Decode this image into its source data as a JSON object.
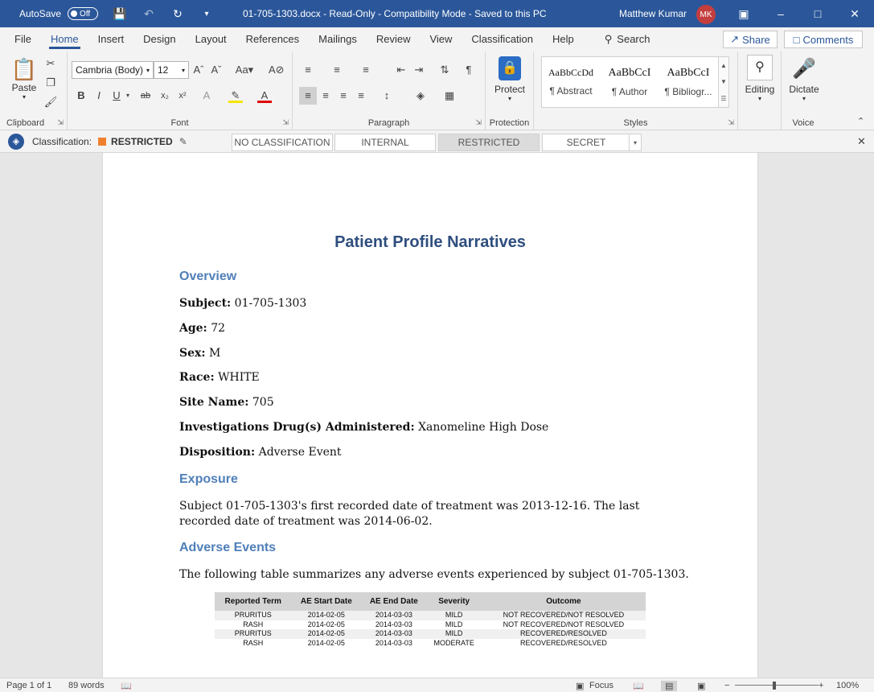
{
  "titlebar": {
    "autosave_label": "AutoSave",
    "autosave_state": "Off",
    "title": "01-705-1303.docx  -  Read-Only  -  Compatibility Mode  -  Saved to this PC",
    "user_name": "Matthew Kumar",
    "user_initials": "MK"
  },
  "tabs": [
    "File",
    "Home",
    "Insert",
    "Design",
    "Layout",
    "References",
    "Mailings",
    "Review",
    "View",
    "Classification",
    "Help"
  ],
  "active_tab": "Home",
  "search_label": "Search",
  "share_label": "Share",
  "comments_label": "Comments",
  "ribbon": {
    "clipboard": {
      "label": "Clipboard",
      "paste": "Paste"
    },
    "font": {
      "label": "Font",
      "family": "Cambria (Body)",
      "size": "12"
    },
    "paragraph": {
      "label": "Paragraph"
    },
    "protection": {
      "label": "Protection",
      "protect": "Protect"
    },
    "styles": {
      "label": "Styles",
      "items": [
        {
          "sample": "AaBbCcDd",
          "name": "¶ Abstract"
        },
        {
          "sample": "AaBbCcI",
          "name": "¶ Author"
        },
        {
          "sample": "AaBbCcI",
          "name": "¶ Bibliogr..."
        }
      ]
    },
    "editing": {
      "label": "Editing"
    },
    "voice": {
      "label": "Voice",
      "dictate": "Dictate"
    }
  },
  "classification": {
    "label": "Classification:",
    "current": "RESTRICTED",
    "swatch_color": "#f08030",
    "options": [
      "NO CLASSIFICATION",
      "INTERNAL",
      "RESTRICTED",
      "SECRET"
    ],
    "selected": "RESTRICTED"
  },
  "document": {
    "title": "Patient Profile Narratives",
    "overview_heading": "Overview",
    "fields": [
      {
        "label": "Subject:",
        "value": "01-705-1303"
      },
      {
        "label": "Age:",
        "value": "72"
      },
      {
        "label": "Sex:",
        "value": "M"
      },
      {
        "label": "Race:",
        "value": "WHITE"
      },
      {
        "label": "Site Name:",
        "value": "705"
      },
      {
        "label": "Investigations Drug(s) Administered:",
        "value": "Xanomeline High Dose"
      },
      {
        "label": "Disposition:",
        "value": "Adverse Event"
      }
    ],
    "exposure_heading": "Exposure",
    "exposure_text": "Subject 01-705-1303's first recorded date of treatment was 2013-12-16. The last recorded date of treatment was 2014-06-02.",
    "ae_heading": "Adverse Events",
    "ae_text": "The following table summarizes any adverse events experienced by subject 01-705-1303.",
    "ae_table": {
      "headers": [
        "Reported Term",
        "AE Start Date",
        "AE End Date",
        "Severity",
        "Outcome"
      ],
      "rows": [
        [
          "PRURITUS",
          "2014-02-05",
          "2014-03-03",
          "MILD",
          "NOT RECOVERED/NOT RESOLVED"
        ],
        [
          "RASH",
          "2014-02-05",
          "2014-03-03",
          "MILD",
          "NOT RECOVERED/NOT RESOLVED"
        ],
        [
          "PRURITUS",
          "2014-02-05",
          "2014-03-03",
          "MILD",
          "RECOVERED/RESOLVED"
        ],
        [
          "RASH",
          "2014-02-05",
          "2014-03-03",
          "MODERATE",
          "RECOVERED/RESOLVED"
        ]
      ]
    }
  },
  "statusbar": {
    "page": "Page 1 of 1",
    "words": "89 words",
    "focus": "Focus",
    "zoom": "100%"
  }
}
